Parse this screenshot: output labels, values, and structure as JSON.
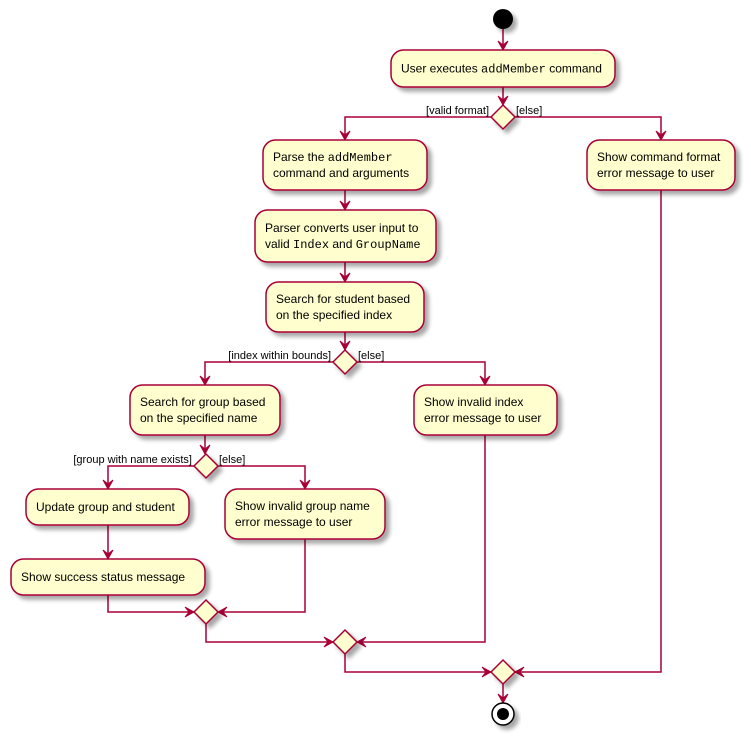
{
  "diagram": {
    "type": "activity",
    "colors": {
      "border": "#A80036",
      "fill": "#FEFECE",
      "node": "#000000"
    },
    "nodes": {
      "start": {
        "kind": "start"
      },
      "user_exec": {
        "kind": "action",
        "lines": [
          [
            {
              "t": "User executes "
            },
            {
              "t": "addMember",
              "mono": true
            },
            {
              "t": " command"
            }
          ]
        ]
      },
      "dec_format": {
        "kind": "decision",
        "yes": "[valid format]",
        "no": "[else]"
      },
      "parse": {
        "kind": "action",
        "lines": [
          [
            {
              "t": "Parse the "
            },
            {
              "t": "addMember",
              "mono": true
            }
          ],
          [
            {
              "t": "command and arguments"
            }
          ]
        ]
      },
      "convert": {
        "kind": "action",
        "lines": [
          [
            {
              "t": "Parser converts user input to"
            }
          ],
          [
            {
              "t": "valid "
            },
            {
              "t": "Index",
              "mono": true
            },
            {
              "t": " and "
            },
            {
              "t": "GroupName",
              "mono": true
            }
          ]
        ]
      },
      "search_student": {
        "kind": "action",
        "lines": [
          [
            {
              "t": "Search for student based"
            }
          ],
          [
            {
              "t": "on the specified index"
            }
          ]
        ]
      },
      "dec_index": {
        "kind": "decision",
        "yes": "[index within bounds]",
        "no": "[else]"
      },
      "search_group": {
        "kind": "action",
        "lines": [
          [
            {
              "t": "Search for group based"
            }
          ],
          [
            {
              "t": "on the specified name"
            }
          ]
        ]
      },
      "dec_group": {
        "kind": "decision",
        "yes": "[group with name exists]",
        "no": "[else]"
      },
      "update": {
        "kind": "action",
        "lines": [
          [
            {
              "t": "Update group and student"
            }
          ]
        ]
      },
      "success": {
        "kind": "action",
        "lines": [
          [
            {
              "t": "Show success status message"
            }
          ]
        ]
      },
      "invalid_group": {
        "kind": "action",
        "lines": [
          [
            {
              "t": "Show invalid group name"
            }
          ],
          [
            {
              "t": " error message to user"
            }
          ]
        ]
      },
      "invalid_index": {
        "kind": "action",
        "lines": [
          [
            {
              "t": "Show invalid index"
            }
          ],
          [
            {
              "t": "error message to user"
            }
          ]
        ]
      },
      "format_error": {
        "kind": "action",
        "lines": [
          [
            {
              "t": "Show command format"
            }
          ],
          [
            {
              "t": " error message to user"
            }
          ]
        ]
      },
      "merge_group": {
        "kind": "merge"
      },
      "merge_index": {
        "kind": "merge"
      },
      "merge_format": {
        "kind": "merge"
      },
      "end": {
        "kind": "end"
      }
    }
  }
}
